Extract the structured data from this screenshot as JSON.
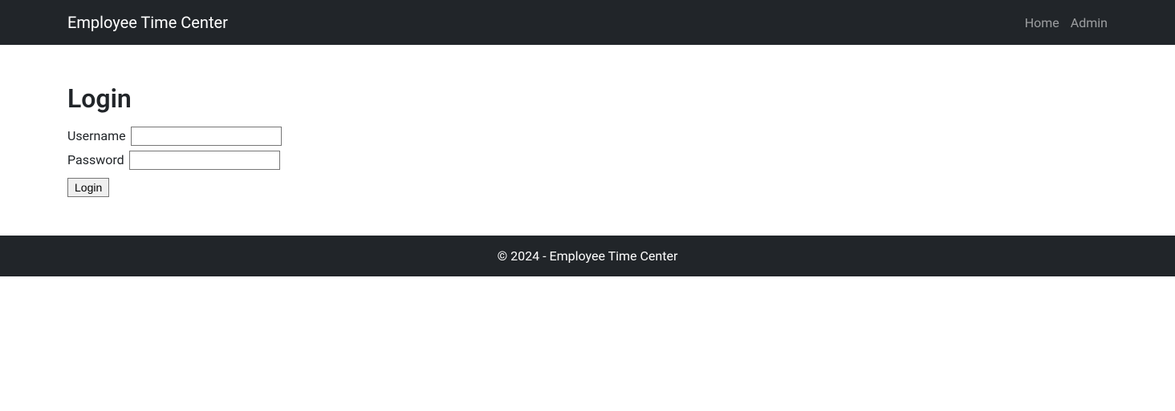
{
  "navbar": {
    "brand": "Employee Time Center",
    "links": [
      {
        "label": "Home"
      },
      {
        "label": "Admin"
      }
    ]
  },
  "page": {
    "title": "Login"
  },
  "form": {
    "username_label": "Username",
    "username_value": "",
    "password_label": "Password",
    "password_value": "",
    "submit_label": "Login"
  },
  "footer": {
    "text": "© 2024 - Employee Time Center"
  }
}
